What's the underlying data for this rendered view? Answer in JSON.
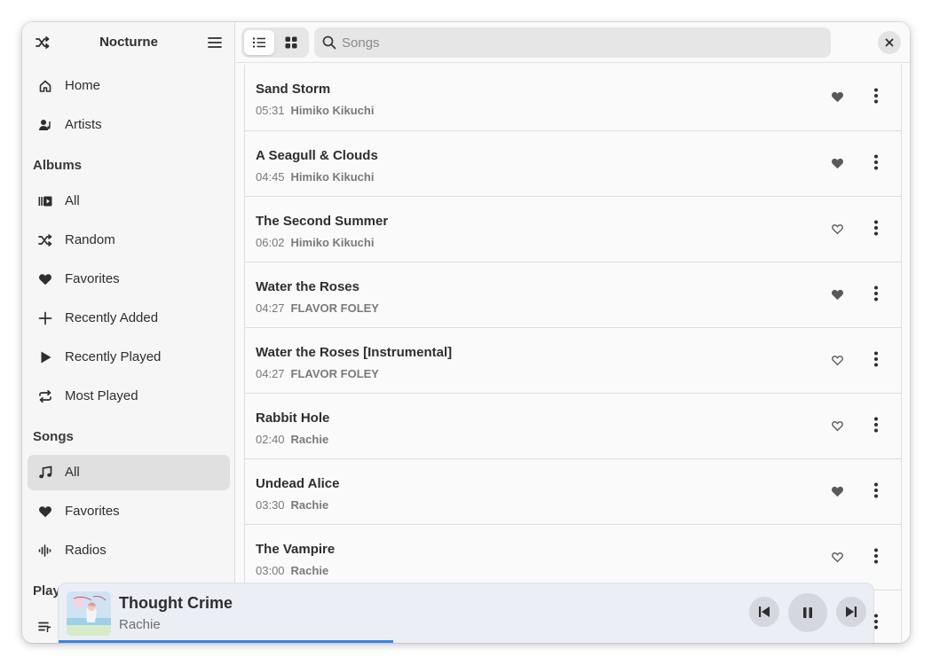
{
  "app": {
    "title": "Nocturne"
  },
  "sidebar": {
    "top_items": [
      {
        "label": "Home",
        "icon": "home-icon"
      },
      {
        "label": "Artists",
        "icon": "artist-icon"
      }
    ],
    "albums_header": "Albums",
    "album_items": [
      {
        "label": "All",
        "icon": "album-library-icon"
      },
      {
        "label": "Random",
        "icon": "shuffle-icon"
      },
      {
        "label": "Favorites",
        "icon": "heart-icon"
      },
      {
        "label": "Recently Added",
        "icon": "plus-icon"
      },
      {
        "label": "Recently Played",
        "icon": "play-icon"
      },
      {
        "label": "Most Played",
        "icon": "repeat-icon"
      }
    ],
    "songs_header": "Songs",
    "song_items": [
      {
        "label": "All",
        "icon": "music-note-icon",
        "active": true
      },
      {
        "label": "Favorites",
        "icon": "heart-icon"
      },
      {
        "label": "Radios",
        "icon": "radio-waves-icon"
      }
    ],
    "playlists_header": "Playl",
    "playlist_items": [
      {
        "icon": "playlist-icon"
      }
    ]
  },
  "search": {
    "placeholder": "Songs",
    "value": ""
  },
  "songs": [
    {
      "title": "Sand Storm",
      "duration": "05:31",
      "artist": "Himiko Kikuchi",
      "favorite": true
    },
    {
      "title": "A Seagull & Clouds",
      "duration": "04:45",
      "artist": "Himiko Kikuchi",
      "favorite": true
    },
    {
      "title": "The Second Summer",
      "duration": "06:02",
      "artist": "Himiko Kikuchi",
      "favorite": false
    },
    {
      "title": "Water the Roses",
      "duration": "04:27",
      "artist": "FLAVOR FOLEY",
      "favorite": true
    },
    {
      "title": "Water the Roses [Instrumental]",
      "duration": "04:27",
      "artist": "FLAVOR FOLEY",
      "favorite": false
    },
    {
      "title": "Rabbit Hole",
      "duration": "02:40",
      "artist": "Rachie",
      "favorite": false
    },
    {
      "title": "Undead Alice",
      "duration": "03:30",
      "artist": "Rachie",
      "favorite": true
    },
    {
      "title": "The Vampire",
      "duration": "03:00",
      "artist": "Rachie",
      "favorite": false
    },
    {
      "title": "",
      "duration": "",
      "artist": "",
      "favorite": false
    }
  ],
  "player": {
    "title": "Thought Crime",
    "artist": "Rachie",
    "progress_fraction": 0.41,
    "state": "playing"
  },
  "colors": {
    "accent": "#3584e4",
    "heart": "#5a5a5a"
  }
}
